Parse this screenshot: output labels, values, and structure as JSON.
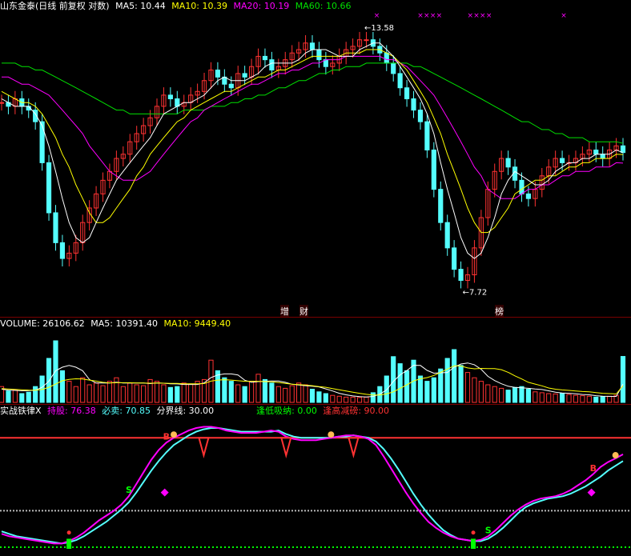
{
  "price_panel": {
    "header": {
      "symbol": "山东金泰(日线 前复权 对数)",
      "ma5": "MA5: 10.44",
      "ma10": "MA10: 10.39",
      "ma20": "MA20: 10.19",
      "ma60": "MA60: 10.66"
    },
    "high_label": "13.58",
    "low_label": "7.72",
    "events": [
      "增",
      "财",
      "榜"
    ],
    "colors": {
      "up": "#ff3232",
      "down": "#54ffff",
      "ma5": "#ffffff",
      "ma10": "#ffff00",
      "ma20": "#ff00ff",
      "ma60": "#00e000",
      "marks": "#ff00ff"
    }
  },
  "volume_panel": {
    "header": {
      "volume": "VOLUME: 26106.62",
      "ma5": "MA5: 10391.40",
      "ma10": "MA10: 9449.40"
    }
  },
  "indicator_panel": {
    "header": {
      "name": "实战铁律X",
      "hold": "持股: 76.38",
      "must_sell": "必卖: 70.85",
      "boundary": "分界线: 30.00",
      "low_absorb": "逢低吸纳: 0.00",
      "high_reduce": "逢高减磅: 90.00"
    },
    "signals": {
      "buy": "B",
      "sell": "S"
    }
  },
  "chart_data": [
    {
      "type": "candlestick",
      "title": "山东金泰(日线 前复权 对数)",
      "scale": "log",
      "ylim": [
        7.5,
        14.2
      ],
      "annotations": [
        {
          "label": "13.58",
          "kind": "high"
        },
        {
          "label": "7.72",
          "kind": "low"
        }
      ],
      "series": [
        {
          "name": "MA5",
          "color": "#ffffff",
          "last": 10.44
        },
        {
          "name": "MA10",
          "color": "#ffff00",
          "last": 10.39
        },
        {
          "name": "MA20",
          "color": "#ff00ff",
          "last": 10.19
        },
        {
          "name": "MA60",
          "color": "#00e000",
          "last": 10.66
        }
      ],
      "close": [
        11.7,
        11.6,
        11.8,
        11.6,
        11.5,
        11.2,
        10.2,
        9.1,
        8.5,
        8.2,
        8.3,
        8.5,
        8.9,
        9.2,
        9.5,
        9.8,
        10.0,
        10.3,
        10.4,
        10.7,
        10.9,
        11.1,
        11.3,
        11.6,
        11.9,
        11.8,
        11.6,
        11.7,
        11.9,
        12.0,
        12.3,
        12.6,
        12.4,
        12.2,
        12.1,
        12.5,
        12.4,
        12.7,
        13.0,
        12.9,
        12.6,
        12.7,
        12.9,
        13.1,
        13.2,
        13.4,
        13.2,
        12.9,
        12.7,
        12.8,
        13.0,
        13.2,
        13.3,
        13.5,
        13.5,
        13.3,
        13.1,
        12.8,
        12.5,
        12.1,
        11.8,
        11.5,
        11.2,
        10.5,
        9.6,
        8.9,
        8.4,
        8.0,
        7.8,
        7.9,
        8.4,
        9.0,
        9.6,
        10.0,
        10.3,
        10.1,
        9.8,
        9.5,
        9.4,
        9.6,
        9.9,
        10.1,
        10.3,
        10.2,
        10.2,
        10.3,
        10.4,
        10.5,
        10.4,
        10.3,
        10.5,
        10.6,
        10.44
      ],
      "ma5": [
        11.8,
        11.7,
        11.6,
        11.6,
        11.6,
        11.4,
        11.1,
        10.6,
        10.0,
        9.4,
        8.9,
        8.6,
        8.5,
        8.6,
        8.9,
        9.2,
        9.5,
        9.8,
        10.0,
        10.2,
        10.4,
        10.6,
        10.8,
        11.1,
        11.4,
        11.5,
        11.6,
        11.7,
        11.7,
        11.8,
        11.9,
        12.1,
        12.3,
        12.4,
        12.3,
        12.3,
        12.3,
        12.4,
        12.5,
        12.7,
        12.8,
        12.8,
        12.8,
        12.8,
        12.9,
        13.1,
        13.2,
        13.2,
        13.2,
        13.1,
        13.0,
        13.0,
        13.0,
        13.2,
        13.3,
        13.4,
        13.4,
        13.2,
        13.0,
        12.7,
        12.4,
        12.1,
        11.8,
        11.4,
        10.9,
        10.2,
        9.6,
        9.1,
        8.6,
        8.3,
        8.2,
        8.3,
        8.6,
        9.0,
        9.5,
        9.8,
        10.0,
        9.9,
        9.8,
        9.7,
        9.7,
        9.8,
        10.0,
        10.1,
        10.2,
        10.2,
        10.3,
        10.3,
        10.4,
        10.4,
        10.4,
        10.5,
        10.44
      ],
      "ma10": [
        12.0,
        11.9,
        11.8,
        11.7,
        11.7,
        11.6,
        11.4,
        11.1,
        10.8,
        10.4,
        10.1,
        9.7,
        9.4,
        9.1,
        8.9,
        8.9,
        9.0,
        9.2,
        9.4,
        9.6,
        9.9,
        10.1,
        10.4,
        10.6,
        10.8,
        11.0,
        11.2,
        11.3,
        11.5,
        11.6,
        11.7,
        11.8,
        11.9,
        12.0,
        12.0,
        12.1,
        12.2,
        12.3,
        12.4,
        12.4,
        12.5,
        12.6,
        12.6,
        12.7,
        12.8,
        12.9,
        13.0,
        13.0,
        13.0,
        13.0,
        13.0,
        13.1,
        13.1,
        13.1,
        13.2,
        13.2,
        13.2,
        13.1,
        13.0,
        12.8,
        12.6,
        12.3,
        12.0,
        11.7,
        11.3,
        10.9,
        10.4,
        10.0,
        9.6,
        9.2,
        8.9,
        8.7,
        8.7,
        8.8,
        9.0,
        9.2,
        9.5,
        9.6,
        9.7,
        9.8,
        9.8,
        9.9,
        9.9,
        10.0,
        10.1,
        10.1,
        10.2,
        10.2,
        10.3,
        10.3,
        10.3,
        10.4,
        10.39
      ],
      "ma20": [
        12.4,
        12.4,
        12.3,
        12.2,
        12.2,
        12.1,
        12.0,
        11.9,
        11.7,
        11.5,
        11.3,
        11.1,
        10.9,
        10.6,
        10.4,
        10.2,
        10.0,
        9.9,
        9.8,
        9.8,
        9.8,
        9.9,
        10.0,
        10.2,
        10.4,
        10.6,
        10.8,
        11.0,
        11.2,
        11.3,
        11.5,
        11.6,
        11.7,
        11.8,
        11.9,
        12.0,
        12.1,
        12.2,
        12.2,
        12.3,
        12.4,
        12.5,
        12.5,
        12.6,
        12.6,
        12.7,
        12.8,
        12.8,
        12.9,
        12.9,
        12.9,
        13.0,
        13.0,
        13.0,
        13.0,
        13.0,
        13.0,
        12.9,
        12.9,
        12.8,
        12.7,
        12.5,
        12.3,
        12.1,
        11.9,
        11.6,
        11.3,
        11.0,
        10.7,
        10.4,
        10.1,
        9.9,
        9.6,
        9.5,
        9.4,
        9.4,
        9.4,
        9.5,
        9.6,
        9.6,
        9.7,
        9.7,
        9.8,
        9.9,
        9.9,
        10.0,
        10.0,
        10.0,
        10.1,
        10.1,
        10.1,
        10.2,
        10.19
      ],
      "ma60": [
        12.8,
        12.8,
        12.8,
        12.7,
        12.7,
        12.6,
        12.6,
        12.5,
        12.4,
        12.3,
        12.2,
        12.1,
        12.0,
        11.9,
        11.8,
        11.7,
        11.6,
        11.5,
        11.5,
        11.4,
        11.4,
        11.4,
        11.4,
        11.4,
        11.4,
        11.4,
        11.4,
        11.5,
        11.5,
        11.5,
        11.5,
        11.6,
        11.6,
        11.6,
        11.7,
        11.7,
        11.8,
        11.8,
        11.9,
        11.9,
        12.0,
        12.1,
        12.1,
        12.2,
        12.3,
        12.3,
        12.4,
        12.5,
        12.5,
        12.6,
        12.6,
        12.7,
        12.7,
        12.7,
        12.8,
        12.8,
        12.8,
        12.8,
        12.8,
        12.8,
        12.8,
        12.7,
        12.7,
        12.6,
        12.5,
        12.4,
        12.3,
        12.2,
        12.1,
        12.0,
        11.9,
        11.8,
        11.7,
        11.6,
        11.5,
        11.4,
        11.3,
        11.2,
        11.2,
        11.1,
        11.0,
        11.0,
        10.9,
        10.9,
        10.8,
        10.8,
        10.8,
        10.7,
        10.7,
        10.7,
        10.7,
        10.7,
        10.66
      ]
    },
    {
      "type": "bar",
      "title": "VOLUME",
      "ylim": [
        0,
        40000
      ],
      "values": [
        9000,
        6500,
        7200,
        5000,
        5800,
        9000,
        15000,
        25000,
        35000,
        18000,
        12000,
        9000,
        14000,
        10000,
        11000,
        9500,
        12000,
        14000,
        9000,
        11000,
        10000,
        9500,
        13000,
        12000,
        10000,
        8500,
        9000,
        11000,
        10500,
        12000,
        13000,
        24000,
        18000,
        14000,
        12000,
        10000,
        9000,
        12000,
        16000,
        13000,
        11000,
        9000,
        8000,
        9500,
        11000,
        10000,
        7500,
        6000,
        5000,
        4000,
        3500,
        3000,
        3000,
        2800,
        3000,
        5500,
        9000,
        15000,
        26000,
        22000,
        18000,
        24000,
        15000,
        12000,
        14000,
        19000,
        25000,
        30000,
        21000,
        17000,
        14000,
        12000,
        10000,
        9000,
        8000,
        7000,
        8500,
        9000,
        7500,
        6000,
        5500,
        5000,
        4800,
        5200,
        4500,
        4000,
        3800,
        3500,
        3000,
        3200,
        3500,
        4000,
        26106.62
      ],
      "ma5": [
        7500,
        7000,
        6800,
        6600,
        6700,
        6900,
        8600,
        12000,
        18000,
        20000,
        21000,
        20000,
        18000,
        13000,
        11000,
        11000,
        11000,
        11500,
        11000,
        11000,
        11000,
        11000,
        10700,
        11100,
        10900,
        10600,
        10500,
        10200,
        10200,
        10200,
        11100,
        14100,
        15600,
        16200,
        16200,
        15600,
        12600,
        11400,
        11800,
        12000,
        12200,
        12200,
        11400,
        10300,
        9900,
        9500,
        9200,
        8800,
        7700,
        6500,
        5200,
        4300,
        3700,
        3300,
        3100,
        3400,
        4700,
        7100,
        11900,
        15700,
        18100,
        21100,
        21000,
        18200,
        16600,
        16800,
        17000,
        20000,
        21800,
        22400,
        21400,
        18800,
        14800,
        12400,
        10600,
        9200,
        8500,
        8300,
        8000,
        7600,
        7300,
        6600,
        5800,
        5300,
        5200,
        4900,
        4500,
        4300,
        3800,
        3500,
        3400,
        3400,
        10391.4
      ],
      "ma10": [
        7800,
        7600,
        7400,
        7200,
        7000,
        6900,
        7300,
        8600,
        10400,
        12300,
        13100,
        13400,
        13300,
        12700,
        12100,
        11400,
        11100,
        11200,
        11200,
        11200,
        11000,
        11000,
        10900,
        11000,
        10900,
        10800,
        10800,
        10600,
        10600,
        10600,
        10700,
        12100,
        12700,
        12900,
        12700,
        12300,
        12000,
        12000,
        12000,
        11800,
        11700,
        11300,
        10800,
        10300,
        10100,
        9800,
        9500,
        9000,
        8600,
        7800,
        7200,
        6500,
        5800,
        5200,
        4600,
        4200,
        4200,
        4800,
        6000,
        8000,
        10000,
        12200,
        13400,
        14100,
        15300,
        17100,
        18900,
        20800,
        20700,
        19600,
        19100,
        19300,
        19200,
        19200,
        18600,
        17100,
        15100,
        13300,
        11400,
        10400,
        9400,
        8200,
        7500,
        7100,
        6800,
        6500,
        6200,
        6000,
        5600,
        5200,
        5000,
        4800,
        9449.4
      ]
    },
    {
      "type": "line",
      "title": "实战铁律X",
      "ylim": [
        0,
        100
      ],
      "series": [
        {
          "name": "持股",
          "color": "#ff00ff",
          "last": 76.38,
          "values": [
            11,
            9,
            8,
            7,
            6,
            5,
            4,
            3,
            3,
            5,
            8,
            12,
            17,
            22,
            26,
            30,
            35,
            42,
            52,
            62,
            72,
            80,
            86,
            90,
            93,
            96,
            98,
            99,
            99,
            98,
            96,
            95,
            94,
            94,
            94,
            95,
            96,
            95,
            91,
            89,
            88,
            88,
            88,
            89,
            90,
            91,
            92,
            92,
            91,
            89,
            84,
            75,
            65,
            55,
            45,
            36,
            28,
            21,
            16,
            12,
            9,
            7,
            6,
            5,
            6,
            9,
            14,
            20,
            26,
            31,
            35,
            38,
            40,
            41,
            42,
            44,
            47,
            51,
            55,
            60,
            66,
            70,
            73,
            76.38
          ]
        },
        {
          "name": "必卖",
          "color": "#54ffff",
          "last": 70.85,
          "values": [
            13,
            11,
            9,
            8,
            7,
            6,
            5,
            4,
            3,
            4,
            6,
            9,
            13,
            17,
            21,
            26,
            31,
            37,
            45,
            54,
            63,
            71,
            78,
            84,
            88,
            92,
            95,
            97,
            98,
            98,
            97,
            96,
            95,
            95,
            95,
            95,
            95,
            96,
            93,
            91,
            90,
            90,
            90,
            90,
            90,
            91,
            91,
            92,
            91,
            90,
            87,
            81,
            73,
            64,
            54,
            44,
            35,
            27,
            20,
            14,
            10,
            7,
            6,
            5,
            5,
            7,
            11,
            16,
            22,
            28,
            33,
            36,
            38,
            40,
            41,
            42,
            44,
            47,
            50,
            54,
            58,
            63,
            67,
            70.85
          ]
        }
      ],
      "thresholds": [
        {
          "name": "分界线",
          "value": 30.0
        },
        {
          "name": "逢低吸纳",
          "value": 0.0
        },
        {
          "name": "逢高减磅",
          "value": 90.0
        }
      ]
    }
  ]
}
